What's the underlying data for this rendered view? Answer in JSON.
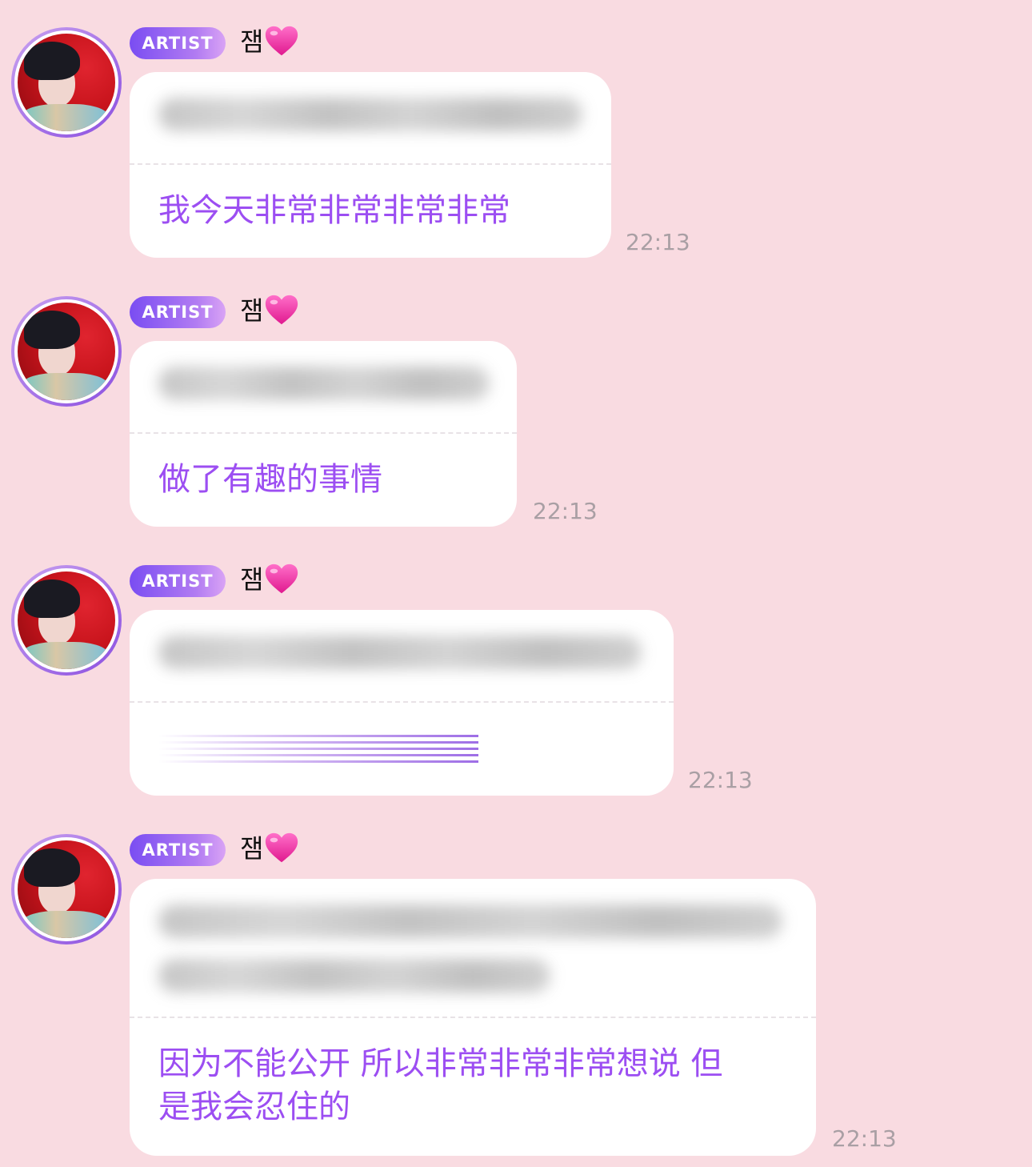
{
  "messages": [
    {
      "badge": "ARTIST",
      "sender": "잼",
      "heart_emoji": "pink-heart",
      "original_hidden": true,
      "translation": "我今天非常非常非常非常",
      "time": "22:13"
    },
    {
      "badge": "ARTIST",
      "sender": "잼",
      "heart_emoji": "pink-heart",
      "original_hidden": true,
      "translation": "做了有趣的事情",
      "time": "22:13"
    },
    {
      "badge": "ARTIST",
      "sender": "잼",
      "heart_emoji": "pink-heart",
      "original_hidden": true,
      "translation": "",
      "translation_hidden": true,
      "time": "22:13"
    },
    {
      "badge": "ARTIST",
      "sender": "잼",
      "heart_emoji": "pink-heart",
      "original_hidden": true,
      "translation": "因为不能公开 所以非常非常非常想说 但是我会忍住的",
      "translation_line1": "因为不能公开 所以非常非常非常想说 但",
      "translation_line2": "是我会忍住的",
      "time": "22:13"
    }
  ],
  "colors": {
    "background": "#f9dbe1",
    "bubble": "#ffffff",
    "translation_text": "#9c4ef2",
    "badge_start": "#7a4df2",
    "badge_end": "#d9a3f5",
    "timestamp": "#a99fa4"
  }
}
